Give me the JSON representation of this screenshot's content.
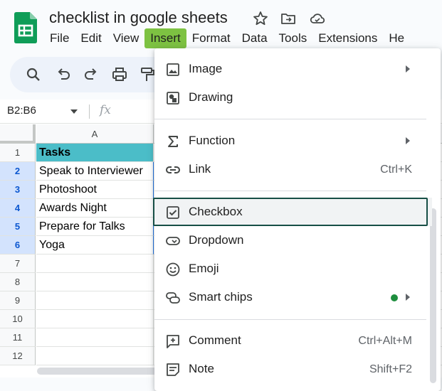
{
  "app": {
    "doc_title": "checklist in google sheets",
    "menus": [
      {
        "label": "File",
        "active": false
      },
      {
        "label": "Edit",
        "active": false
      },
      {
        "label": "View",
        "active": false
      },
      {
        "label": "Insert",
        "active": true
      },
      {
        "label": "Format",
        "active": false
      },
      {
        "label": "Data",
        "active": false
      },
      {
        "label": "Tools",
        "active": false
      },
      {
        "label": "Extensions",
        "active": false
      },
      {
        "label": "He",
        "active": false
      }
    ]
  },
  "toolbar": {
    "icons": [
      "search-icon",
      "undo-icon",
      "redo-icon",
      "print-icon",
      "paint-format-icon"
    ]
  },
  "formula_bar": {
    "name_box": "B2:B6",
    "fx_label": "fx"
  },
  "sheet": {
    "column": "A",
    "rows": [
      {
        "num": "1",
        "value": "Tasks",
        "selected": false,
        "header": true
      },
      {
        "num": "2",
        "value": "Speak to Interviewer",
        "selected": true,
        "header": false
      },
      {
        "num": "3",
        "value": "Photoshoot",
        "selected": true,
        "header": false
      },
      {
        "num": "4",
        "value": "Awards Night",
        "selected": true,
        "header": false
      },
      {
        "num": "5",
        "value": "Prepare for Talks",
        "selected": true,
        "header": false
      },
      {
        "num": "6",
        "value": "Yoga",
        "selected": true,
        "header": false
      },
      {
        "num": "7",
        "value": "",
        "selected": false,
        "header": false
      },
      {
        "num": "8",
        "value": "",
        "selected": false,
        "header": false
      },
      {
        "num": "9",
        "value": "",
        "selected": false,
        "header": false
      },
      {
        "num": "10",
        "value": "",
        "selected": false,
        "header": false
      },
      {
        "num": "11",
        "value": "",
        "selected": false,
        "header": false
      },
      {
        "num": "12",
        "value": "",
        "selected": false,
        "header": false
      }
    ]
  },
  "insert_menu": {
    "groups": [
      [
        {
          "label": "Image",
          "icon": "image-icon",
          "submenu": true,
          "shortcut": ""
        },
        {
          "label": "Drawing",
          "icon": "drawing-icon",
          "submenu": false,
          "shortcut": ""
        }
      ],
      [
        {
          "label": "Function",
          "icon": "sigma-icon",
          "submenu": true,
          "shortcut": ""
        },
        {
          "label": "Link",
          "icon": "link-icon",
          "submenu": false,
          "shortcut": "Ctrl+K"
        }
      ],
      [
        {
          "label": "Checkbox",
          "icon": "checkbox-icon",
          "submenu": false,
          "shortcut": "",
          "highlighted": true
        },
        {
          "label": "Dropdown",
          "icon": "dropdown-icon",
          "submenu": false,
          "shortcut": ""
        },
        {
          "label": "Emoji",
          "icon": "emoji-icon",
          "submenu": false,
          "shortcut": ""
        },
        {
          "label": "Smart chips",
          "icon": "smart-chips-icon",
          "submenu": true,
          "shortcut": "",
          "new_dot": true
        }
      ],
      [
        {
          "label": "Comment",
          "icon": "comment-icon",
          "submenu": false,
          "shortcut": "Ctrl+Alt+M"
        },
        {
          "label": "Note",
          "icon": "note-icon",
          "submenu": false,
          "shortcut": "Shift+F2"
        }
      ]
    ]
  },
  "colors": {
    "header_fill": "#4bbdc8",
    "menu_active": "#7dc242",
    "selection": "#d3e3fd",
    "focus_ring": "#174f46"
  }
}
